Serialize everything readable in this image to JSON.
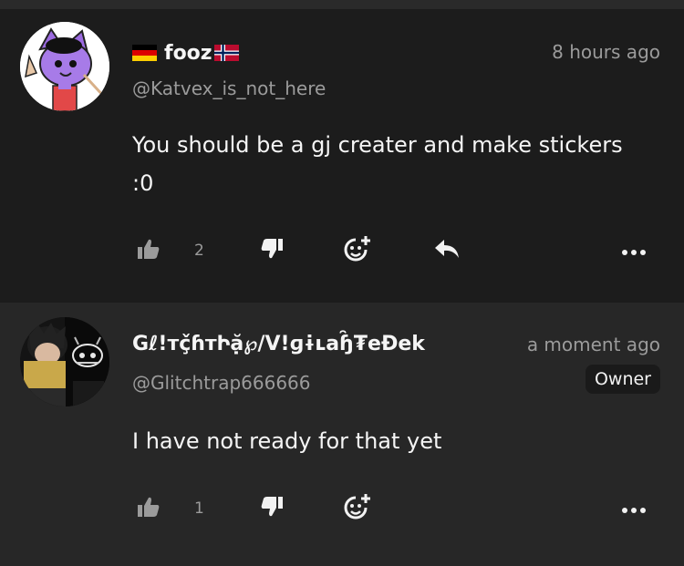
{
  "comments": [
    {
      "username": "fooz",
      "flag_left": "germany-flag",
      "flag_right": "norway-flag",
      "handle": "@Katvex_is_not_here",
      "time": "8 hours ago",
      "text": "You should be a gj creater and make stickers :0",
      "likes": "2",
      "icons": [
        "thumbs-up-icon",
        "thumbs-down-icon",
        "sticker-add-icon",
        "reply-icon",
        "more-icon"
      ]
    },
    {
      "username": "Gℓ!тç̌ɦтԻặ℘/V!ɡɨʟaɧ̑₮eĐek",
      "handle": "@Glitchtrap666666",
      "time": "a moment ago",
      "badge": "Owner",
      "text": "I have not ready for that yet",
      "likes": "1",
      "icons": [
        "thumbs-up-icon",
        "thumbs-down-icon",
        "sticker-add-icon",
        "more-icon"
      ]
    }
  ],
  "colors": {
    "background": "#1c1c1c",
    "highlight_background": "#272727",
    "muted_text": "#9b9b9b",
    "text": "#f5f5f5"
  }
}
